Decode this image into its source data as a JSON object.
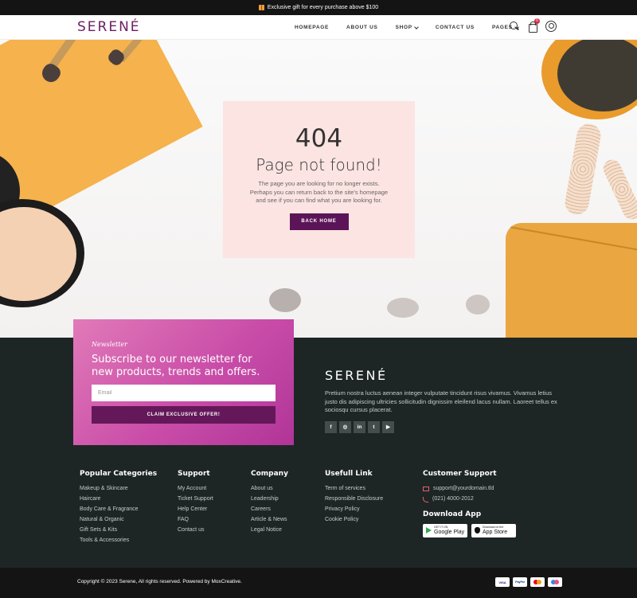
{
  "topbar": {
    "announcement": "Exclusive gift for every purchase above $100"
  },
  "header": {
    "logo": "SERENÉ",
    "nav": [
      "HOMEPAGE",
      "ABOUT US",
      "SHOP",
      "CONTACT US",
      "PAGES"
    ],
    "cart_count": "0"
  },
  "error_page": {
    "code": "404",
    "title": "Page not found!",
    "message": "The page you are looking for no longer exists. Perhaps you can return back to the site's homepage and see if you can find what you are looking for.",
    "button": "BACK HOME"
  },
  "newsletter": {
    "kicker": "Newsletter",
    "heading": "Subscribe to our newsletter for new products, trends and offers.",
    "email_placeholder": "Email",
    "button": "CLAIM EXCLUSIVE OFFER!"
  },
  "footer_brand": {
    "logo": "SERENÉ",
    "description": "Pretium nostra luctus aenean integer vulputate tincidunt risus vivamus. Vivamus letius justo dis adipiscing ultricies sollicitudin dignissim eleifend lacus nullam. Laoreet tellus ex sociosqu cursus placerat.",
    "socials": [
      "f",
      "◎",
      "in",
      "t",
      "▶"
    ]
  },
  "footer_columns": {
    "popular": {
      "title": "Popular Categories",
      "items": [
        "Makeup & Skincare",
        "Haircare",
        "Body Care & Fragrance",
        "Natural & Organic",
        "Gift Sets & Kits",
        "Tools & Accessories"
      ]
    },
    "support": {
      "title": "Support",
      "items": [
        "My Account",
        "Ticket Support",
        "Help Center",
        "FAQ",
        "Contact us"
      ]
    },
    "company": {
      "title": "Company",
      "items": [
        "About us",
        "Leadership",
        "Careers",
        "Article & News",
        "Legal Notice"
      ]
    },
    "useful": {
      "title": "Usefull Link",
      "items": [
        "Term of services",
        "Responsible Disclosure",
        "Privacy Policy",
        "Cookie Policy"
      ]
    }
  },
  "customer_support": {
    "title": "Customer Support",
    "email": "support@yourdomain.tld",
    "phone": "(021) 4000-2012",
    "app_title": "Download App",
    "google_small": "GET IT ON",
    "google_big": "Google Play",
    "apple_small": "Download on the",
    "apple_big": "App Store"
  },
  "bottom": {
    "copyright": "Copyright © 2023 Serene, All rights reserved. Powered by MoxCreative.",
    "payments": [
      "VISA",
      "PayPal",
      "",
      ""
    ]
  }
}
